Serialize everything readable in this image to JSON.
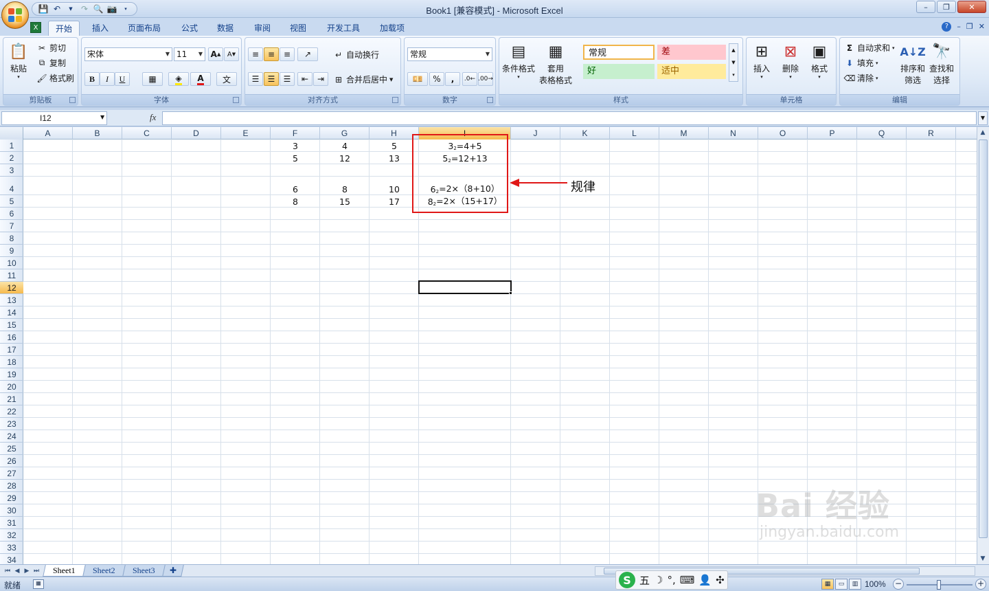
{
  "window": {
    "title": "Book1  [兼容模式] - Microsoft Excel",
    "minimize": "–",
    "maximize": "❐",
    "close": "✕"
  },
  "ribbon_tabs": [
    "开始",
    "插入",
    "页面布局",
    "公式",
    "数据",
    "审阅",
    "视图",
    "开发工具",
    "加载项"
  ],
  "active_tab": "开始",
  "clipboard": {
    "paste": "粘贴",
    "cut": "剪切",
    "copy": "复制",
    "format_painter": "格式刷",
    "label": "剪贴板"
  },
  "font": {
    "name": "宋体",
    "size": "11",
    "label": "字体",
    "bold": "B",
    "italic": "I",
    "underline": "U",
    "font_color_glyph": "A"
  },
  "alignment": {
    "wrap_text": "自动换行",
    "merge_center": "合并后居中",
    "label": "对齐方式"
  },
  "number": {
    "format": "常规",
    "percent": "%",
    "comma": ",",
    "label": "数字"
  },
  "styles": {
    "conditional_format": "条件格式",
    "table_format_line1": "套用",
    "table_format_line2": "表格格式",
    "normal": "常规",
    "bad": "差",
    "good": "好",
    "neutral": "适中",
    "label": "样式",
    "colors": {
      "bad_bg": "#ffc7ce",
      "bad_fg": "#9c0006",
      "good_bg": "#c6efce",
      "good_fg": "#006100",
      "neutral_bg": "#ffeb9c",
      "neutral_fg": "#9c6500"
    }
  },
  "cells_group": {
    "insert": "插入",
    "delete": "删除",
    "format": "格式",
    "label": "单元格"
  },
  "editing": {
    "autosum": "自动求和",
    "fill": "填充",
    "clear": "清除",
    "sort_filter_line1": "排序和",
    "sort_filter_line2": "筛选",
    "find_select_line1": "查找和",
    "find_select_line2": "选择",
    "label": "编辑"
  },
  "formula_bar": {
    "name_box": "I12",
    "fx": "fx",
    "value": ""
  },
  "columns": [
    "A",
    "B",
    "C",
    "D",
    "E",
    "F",
    "G",
    "H",
    "I",
    "J",
    "K",
    "L",
    "M",
    "N",
    "O",
    "P",
    "Q",
    "R"
  ],
  "rows": [
    "1",
    "2",
    "3",
    "4",
    "5",
    "6",
    "7",
    "8",
    "9",
    "10",
    "11",
    "12",
    "13",
    "14",
    "15",
    "16",
    "17",
    "18",
    "19",
    "20",
    "21",
    "22",
    "23",
    "24",
    "25",
    "26",
    "27",
    "28",
    "29",
    "30",
    "31",
    "32",
    "33",
    "34"
  ],
  "selected_cell": "I12",
  "sheet_values": {
    "F1": "3",
    "G1": "4",
    "H1": "5",
    "I1_base": "3",
    "I1_exp": "2",
    "I1_rest": "=4+5",
    "F2": "5",
    "G2": "12",
    "H2": "13",
    "I2_base": "5",
    "I2_exp": "2",
    "I2_rest": "=12+13",
    "F4": "6",
    "G4": "8",
    "H4": "10",
    "I4_base": "6",
    "I4_exp": "2",
    "I4_rest": "=2×（8+10）",
    "F5": "8",
    "G5": "15",
    "H5": "17",
    "I5_base": "8",
    "I5_exp": "2",
    "I5_rest": "=2×（15+17）"
  },
  "annotation": {
    "label": "规律",
    "color": "#e01717"
  },
  "sheets": [
    "Sheet1",
    "Sheet2",
    "Sheet3"
  ],
  "active_sheet": "Sheet1",
  "status": {
    "ready": "就绪",
    "zoom": "100%",
    "ime_mode": "五"
  },
  "watermark": {
    "main": "Bai 经验",
    "sub": "jingyan.baidu.com"
  }
}
